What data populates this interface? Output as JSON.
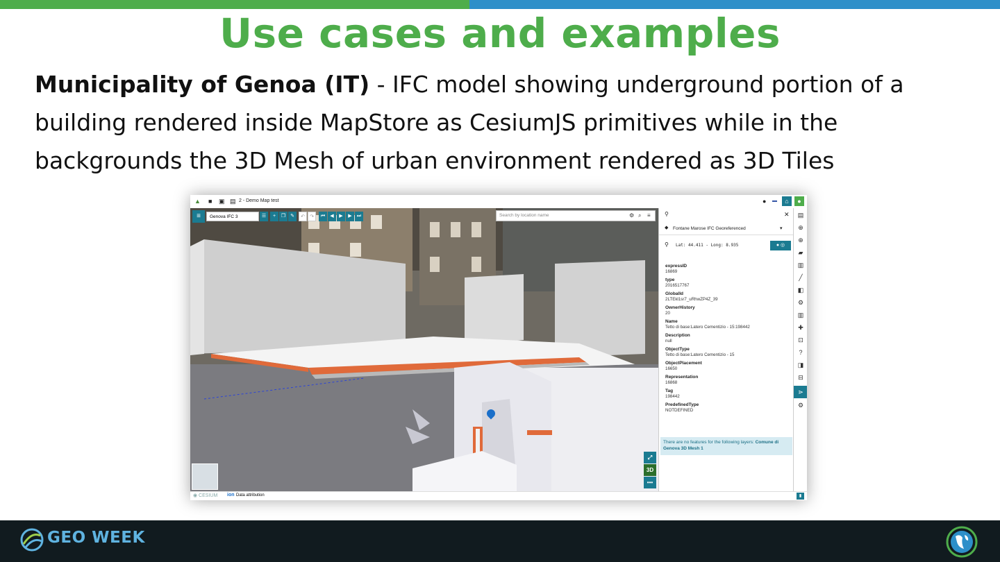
{
  "slide": {
    "title": "Use cases and examples",
    "description_bold": "Municipality of Genoa (IT)",
    "description_rest": " - IFC model showing underground portion of a building rendered inside MapStore as CesiumJS primitives while in the backgrounds the 3D Mesh of urban environment rendered as 3D Tiles"
  },
  "app": {
    "map_title": "2 - Demo Map test",
    "layer_name": "Genova IFC 3",
    "search_placeholder": "Search by location name",
    "view_mode_label": "3D",
    "attribution_label": "Data attribution",
    "ion_label": "ion",
    "panel": {
      "layer_select": "Fontane Marose IFC Georeferenced",
      "coords": "Lat: 44.411 - Long: 8.935",
      "attributes": [
        {
          "key": "expressID",
          "value": "16869"
        },
        {
          "key": "type",
          "value": "2016517767"
        },
        {
          "key": "GlobalId",
          "value": "2LTEkl1sr7_uRhwZP4Z_39"
        },
        {
          "key": "OwnerHistory",
          "value": "20"
        },
        {
          "key": "Name",
          "value": "Tetto di base:Latero Cementizio - 15:198442"
        },
        {
          "key": "Description",
          "value": "null"
        },
        {
          "key": "ObjectType",
          "value": "Tetto di base:Latero Cementizio - 15"
        },
        {
          "key": "ObjectPlacement",
          "value": "16650"
        },
        {
          "key": "Representation",
          "value": "16868"
        },
        {
          "key": "Tag",
          "value": "198442"
        },
        {
          "key": "PredefinedType",
          "value": "NOTDEFINED"
        }
      ],
      "notice_text": "There are no features for the following layers: ",
      "notice_link": "Comune di Genova 3D Mesh 1"
    }
  },
  "footer": {
    "brand": "GEO WEEK"
  },
  "colors": {
    "title_green": "#4ead4b",
    "top_blue": "#2d8fc9",
    "app_teal": "#1b7b91",
    "footer_bg": "#111b1f"
  }
}
